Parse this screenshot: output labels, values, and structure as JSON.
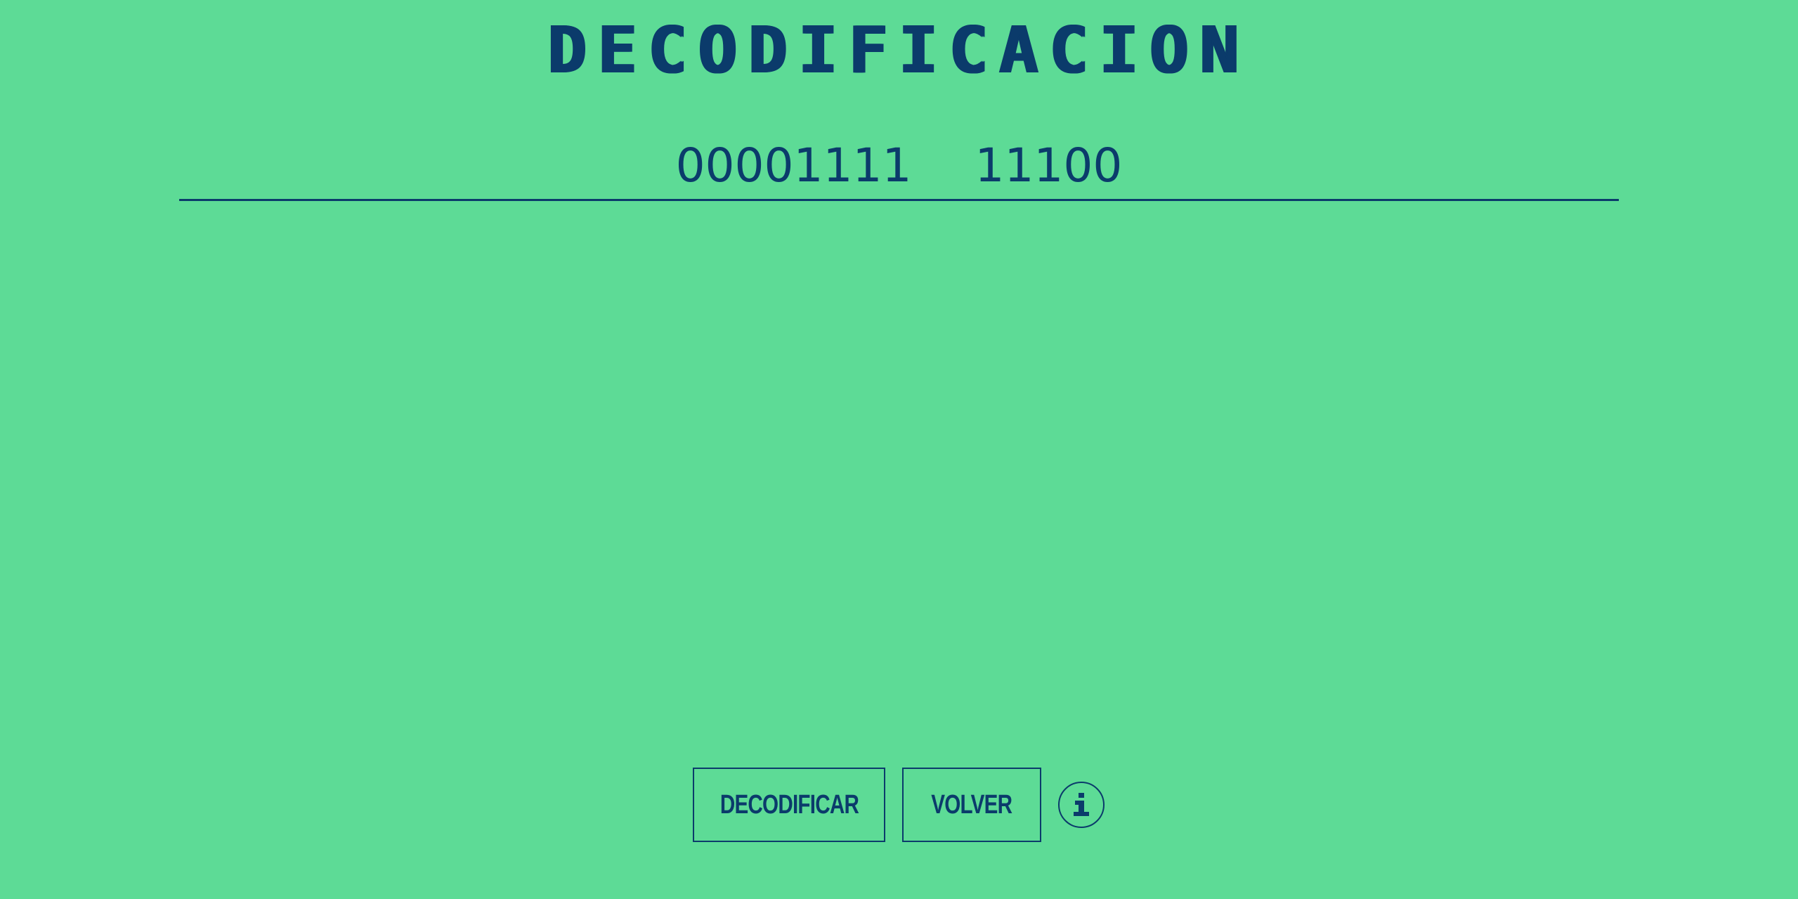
{
  "header": {
    "title": "DECODIFICACION"
  },
  "code": {
    "value": "00001111  11100"
  },
  "actions": {
    "decode_label": "DECODIFICAR",
    "back_label": "VOLVER",
    "info_icon": "info-icon"
  },
  "colors": {
    "background": "#5ddb96",
    "foreground": "#0b3b6b"
  }
}
